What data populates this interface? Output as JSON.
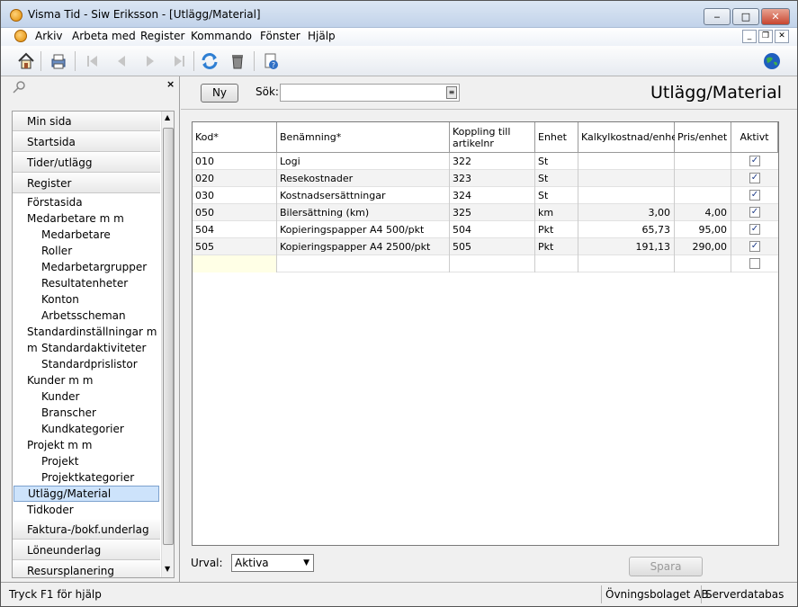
{
  "window": {
    "title": "Visma Tid - Siw Eriksson - [Utlägg/Material]"
  },
  "menu": [
    "Arkiv",
    "Arbeta med",
    "Register",
    "Kommando",
    "Fönster",
    "Hjälp"
  ],
  "toolbar_icons": [
    "home-icon",
    "print-icon",
    "first-icon",
    "prev-icon",
    "next-icon",
    "last-icon",
    "refresh-icon",
    "delete-icon",
    "help-doc-icon",
    "globe-icon"
  ],
  "nav": {
    "items": [
      {
        "label": "Min sida",
        "type": "head"
      },
      {
        "label": "Startsida",
        "type": "head"
      },
      {
        "label": "Tider/utlägg",
        "type": "head"
      },
      {
        "label": "Register",
        "type": "head"
      },
      {
        "label": "Förstasida",
        "type": "l1"
      },
      {
        "label": "Medarbetare m m",
        "type": "l1"
      },
      {
        "label": "Medarbetare",
        "type": "l2"
      },
      {
        "label": "Roller",
        "type": "l2"
      },
      {
        "label": "Medarbetargrupper",
        "type": "l2"
      },
      {
        "label": "Resultatenheter",
        "type": "l2"
      },
      {
        "label": "Konton",
        "type": "l2"
      },
      {
        "label": "Arbetsscheman",
        "type": "l2"
      },
      {
        "label": "Standardinställningar m m",
        "type": "l1"
      },
      {
        "label": "Standardaktiviteter",
        "type": "l2"
      },
      {
        "label": "Standardprislistor",
        "type": "l2"
      },
      {
        "label": "Kunder m m",
        "type": "l1"
      },
      {
        "label": "Kunder",
        "type": "l2"
      },
      {
        "label": "Branscher",
        "type": "l2"
      },
      {
        "label": "Kundkategorier",
        "type": "l2"
      },
      {
        "label": "Projekt m m",
        "type": "l1"
      },
      {
        "label": "Projekt",
        "type": "l2"
      },
      {
        "label": "Projektkategorier",
        "type": "l2"
      },
      {
        "label": "Utlägg/Material",
        "type": "l1sel"
      },
      {
        "label": "Tidkoder",
        "type": "l1"
      },
      {
        "label": "Faktura-/bokf.underlag",
        "type": "head"
      },
      {
        "label": "Löneunderlag",
        "type": "head"
      },
      {
        "label": "Resursplanering",
        "type": "head"
      }
    ]
  },
  "main": {
    "new_label": "Ny",
    "search_label": "Sök:",
    "search_value": "",
    "page_title": "Utlägg/Material",
    "columns": [
      "Kod*",
      "Benämning*",
      "Koppling till artikelnr",
      "Enhet",
      "Kalkylkostnad/enhet",
      "Pris/enhet",
      "Aktivt"
    ],
    "rows": [
      {
        "kod": "010",
        "namn": "Logi",
        "artikel": "322",
        "enhet": "St",
        "kalkyl": "",
        "pris": "",
        "aktiv": true
      },
      {
        "kod": "020",
        "namn": "Resekostnader",
        "artikel": "323",
        "enhet": "St",
        "kalkyl": "",
        "pris": "",
        "aktiv": true
      },
      {
        "kod": "030",
        "namn": "Kostnadsersättningar",
        "artikel": "324",
        "enhet": "St",
        "kalkyl": "",
        "pris": "",
        "aktiv": true
      },
      {
        "kod": "050",
        "namn": "Bilersättning (km)",
        "artikel": "325",
        "enhet": "km",
        "kalkyl": "3,00",
        "pris": "4,00",
        "aktiv": true
      },
      {
        "kod": "504",
        "namn": "Kopieringspapper A4 500/pkt",
        "artikel": "504",
        "enhet": "Pkt",
        "kalkyl": "65,73",
        "pris": "95,00",
        "aktiv": true
      },
      {
        "kod": "505",
        "namn": "Kopieringspapper A4 2500/pkt",
        "artikel": "505",
        "enhet": "Pkt",
        "kalkyl": "191,13",
        "pris": "290,00",
        "aktiv": true
      }
    ],
    "filter_label": "Urval:",
    "filter_value": "Aktiva",
    "save_label": "Spara"
  },
  "status": {
    "help": "Tryck F1 för hjälp",
    "company": "Övningsbolaget AB",
    "db": "Serverdatabas"
  }
}
